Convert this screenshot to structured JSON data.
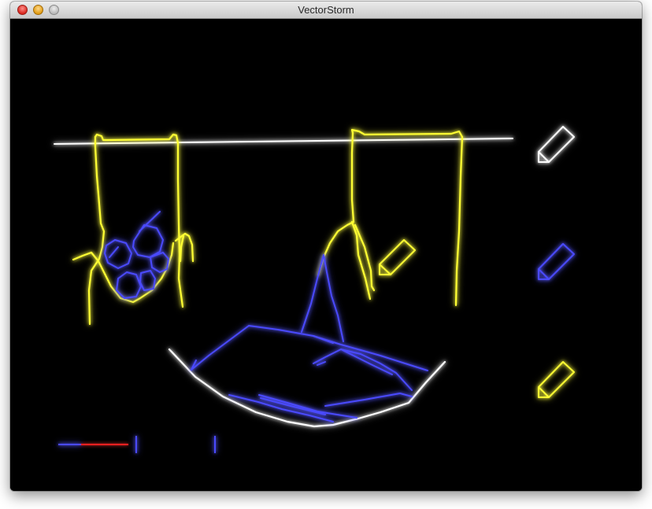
{
  "window": {
    "title": "VectorStorm",
    "buttons": [
      "close",
      "minimize",
      "zoom"
    ]
  },
  "colors": {
    "yellow": "#ffff33",
    "blue": "#4a4aff",
    "white": "#ffffff",
    "red": "#ff2020",
    "background": "#000000"
  },
  "tools": {
    "items": [
      {
        "icon": "pencil-icon",
        "color": "white",
        "selected": true
      },
      {
        "icon": "pencil-icon",
        "color": "blue",
        "selected": false
      },
      {
        "icon": "pencil-icon",
        "color": "yellow",
        "selected": false
      }
    ]
  },
  "hud": {
    "ink_meter_fraction": 0.6
  }
}
